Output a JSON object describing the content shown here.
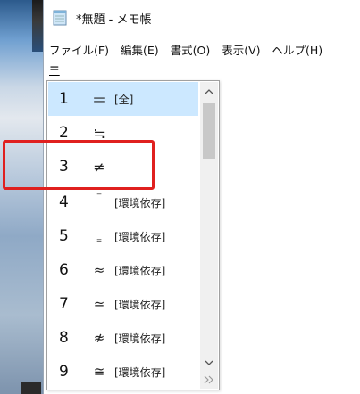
{
  "window": {
    "title": "*無題 - メモ帳",
    "icon": "notepad-icon"
  },
  "menu": {
    "items": [
      "ファイル(F)",
      "編集(E)",
      "書式(O)",
      "表示(V)",
      "ヘルプ(H)"
    ]
  },
  "editor": {
    "text": "="
  },
  "ime": {
    "candidates": [
      {
        "num": "1",
        "symbol": "＝",
        "note": "[全]",
        "selected": true
      },
      {
        "num": "2",
        "symbol": "≒",
        "note": ""
      },
      {
        "num": "3",
        "symbol": "≠",
        "note": ""
      },
      {
        "num": "4",
        "symbol": "⁼",
        "note": "[環境依存]"
      },
      {
        "num": "5",
        "symbol": "₌",
        "note": "[環境依存]"
      },
      {
        "num": "6",
        "symbol": "≈",
        "note": "[環境依存]"
      },
      {
        "num": "7",
        "symbol": "≃",
        "note": "[環境依存]"
      },
      {
        "num": "8",
        "symbol": "≉",
        "note": "[環境依存]"
      },
      {
        "num": "9",
        "symbol": "≅",
        "note": "[環境依存]"
      }
    ],
    "scroll_up_icon": "chevron-up-icon",
    "scroll_down_icon": "chevron-down-icon",
    "expand_icon": "double-chevron-right-icon",
    "selected_color": "#cce8ff",
    "highlight_color": "#e0201f"
  }
}
